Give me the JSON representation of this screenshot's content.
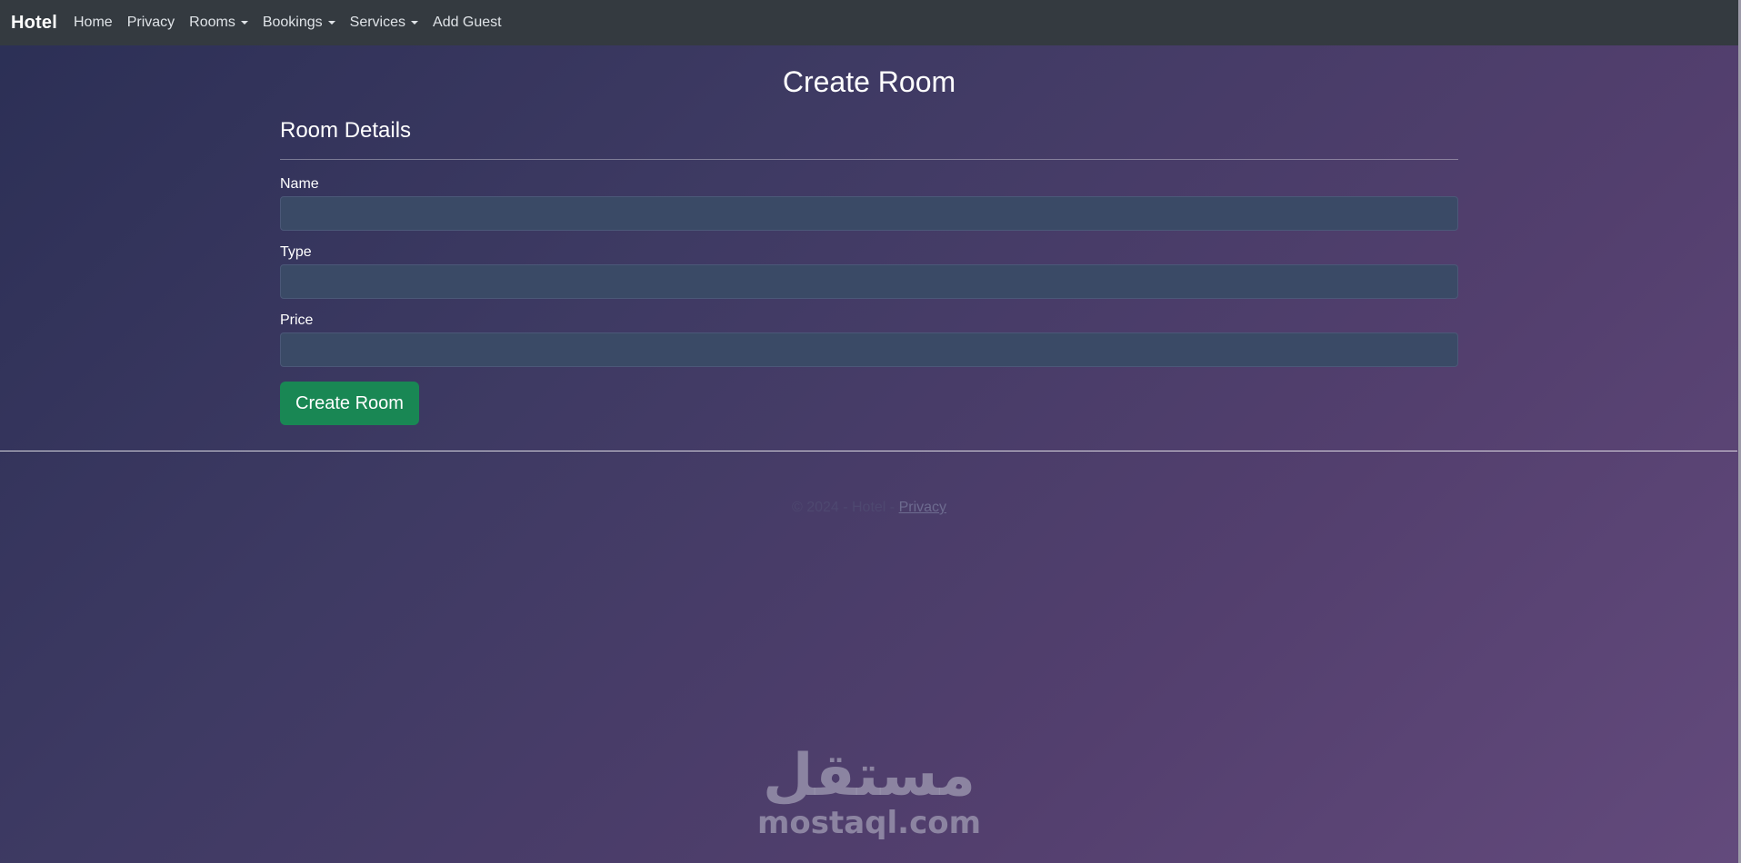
{
  "navbar": {
    "brand": "Hotel",
    "items": [
      {
        "label": "Home",
        "dropdown": false
      },
      {
        "label": "Privacy",
        "dropdown": false
      },
      {
        "label": "Rooms",
        "dropdown": true
      },
      {
        "label": "Bookings",
        "dropdown": true
      },
      {
        "label": "Services",
        "dropdown": true
      },
      {
        "label": "Add Guest",
        "dropdown": false
      }
    ]
  },
  "page": {
    "title": "Create Room"
  },
  "form": {
    "section_heading": "Room Details",
    "fields": [
      {
        "label": "Name",
        "value": ""
      },
      {
        "label": "Type",
        "value": ""
      },
      {
        "label": "Price",
        "value": ""
      }
    ],
    "submit_label": "Create Room"
  },
  "footer": {
    "copyright": "© 2024 - Hotel - ",
    "privacy_link": "Privacy"
  },
  "watermark": {
    "arabic": "مستقل",
    "latin": "mostaql.com"
  },
  "colors": {
    "navbar_bg": "#343a40",
    "button_bg": "#198754",
    "input_bg": "#3a4a66"
  }
}
